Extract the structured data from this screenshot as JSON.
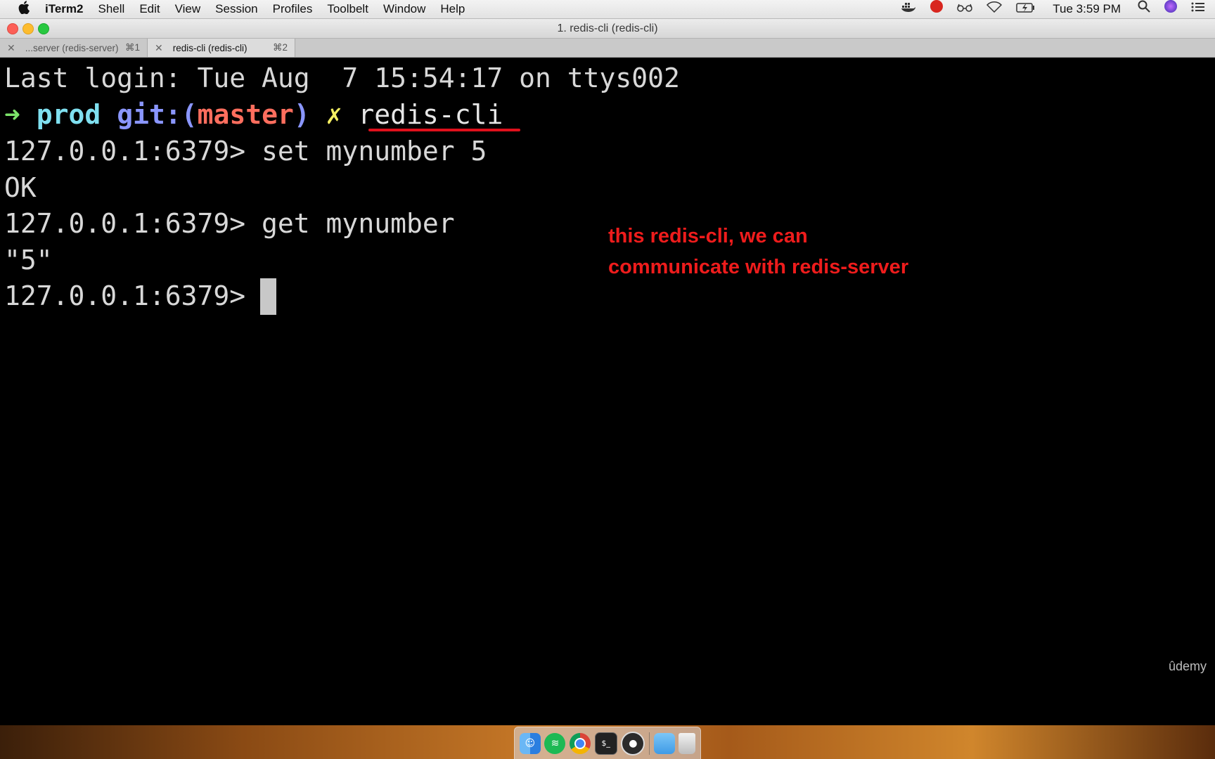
{
  "menubar": {
    "apple_icon": "apple-icon",
    "app_name": "iTerm2",
    "items": [
      "Shell",
      "Edit",
      "View",
      "Session",
      "Profiles",
      "Toolbelt",
      "Window",
      "Help"
    ],
    "clock": "Tue 3:59 PM",
    "status_icons": [
      "docker-icon",
      "creative-cloud-icon",
      "glasses-icon",
      "wifi-icon",
      "battery-charging-icon",
      "search-icon",
      "siri-icon",
      "notification-center-icon"
    ]
  },
  "window": {
    "title": "1. redis-cli (redis-cli)"
  },
  "tabs": [
    {
      "label": "...server (redis-server)",
      "shortcut": "⌘1",
      "active": false
    },
    {
      "label": "redis-cli (redis-cli)",
      "shortcut": "⌘2",
      "active": true
    }
  ],
  "terminal": {
    "last_login": "Last login: Tue Aug  7 15:54:17 on ttys002",
    "prompt": {
      "arrow": "➜",
      "dir": "prod",
      "git_prefix": "git:(",
      "branch": "master",
      "git_suffix": ")",
      "dirty_mark": "✗",
      "command": "redis-cli"
    },
    "lines": [
      "127.0.0.1:6379> set mynumber 5",
      "OK",
      "127.0.0.1:6379> get mynumber",
      "\"5\"",
      "127.0.0.1:6379> "
    ]
  },
  "annotation": {
    "line1": "this redis-cli, we can",
    "line2": "communicate with redis-server",
    "color": "#ee1c1c"
  },
  "watermark": "ûdemy",
  "dock": {
    "apps": [
      "finder-icon",
      "spotify-icon",
      "chrome-icon",
      "terminal-icon",
      "obs-icon",
      "folder-icon",
      "trash-icon"
    ]
  }
}
